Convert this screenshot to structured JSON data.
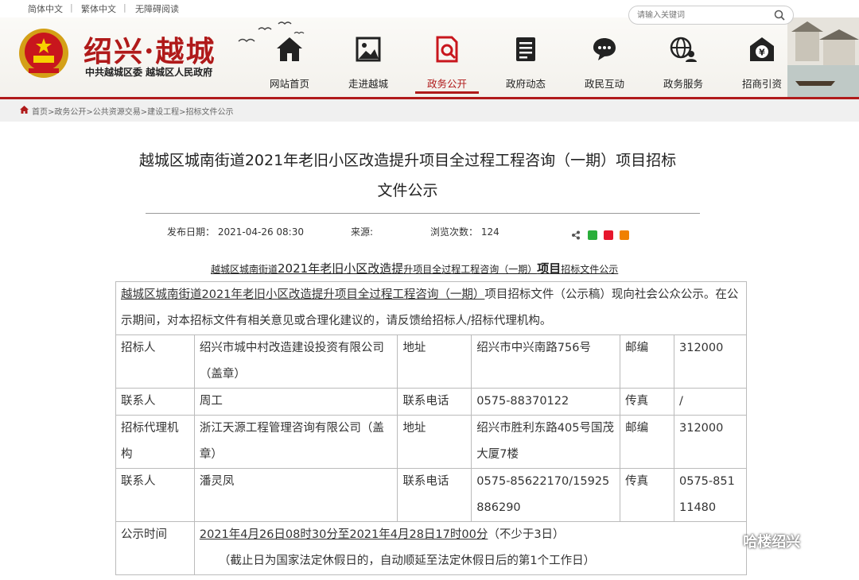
{
  "topbar": {
    "links": [
      "简体中文",
      "繁体中文",
      "无障碍阅读"
    ]
  },
  "search": {
    "placeholder": "请输入关键词"
  },
  "logo": {
    "main": "绍兴·越城",
    "sub": "中共越城区委  越城区人民政府"
  },
  "nav": [
    {
      "label": "网站首页",
      "icon": "home-icon"
    },
    {
      "label": "走进越城",
      "icon": "image-icon"
    },
    {
      "label": "政务公开",
      "icon": "search-doc-icon",
      "active": true
    },
    {
      "label": "政府动态",
      "icon": "document-icon"
    },
    {
      "label": "政民互动",
      "icon": "chat-icon"
    },
    {
      "label": "政务服务",
      "icon": "globe-user-icon"
    },
    {
      "label": "招商引资",
      "icon": "yuan-house-icon"
    }
  ],
  "breadcrumb": "首页>政务公开>公共资源交易>建设工程>招标文件公示",
  "article": {
    "title_line1": "越城区城南街道2021年老旧小区改造提升项目全过程工程咨询（一期）项目招标",
    "title_line2": "文件公示",
    "publish_label": "发布日期：",
    "publish_date": "2021-04-26 08:30",
    "source_label": "来源:",
    "views_label": "浏览次数：",
    "views": "124",
    "subhead_a": "越城区城南街道",
    "subhead_b": "2021年老旧小区改造提",
    "subhead_c": "升项目全过程工程咨询（一期）",
    "subhead_d": "项目",
    "subhead_e": "招标文件公示"
  },
  "table": {
    "intro_underlined": "越城区城南街道2021年老旧小区改造提升项目全过程工程咨询（一期）",
    "intro_rest": "项目招标文件（公示稿）现向社会公众公示。在公示期间，对本招标文件有相关意见或合理化建议的，请反馈给招标人/招标代理机构。",
    "rows": [
      {
        "c1": "招标人",
        "c2": "绍兴市城中村改造建设投资有限公司（盖章）",
        "c3": "地址",
        "c4": "绍兴市中兴南路756号",
        "c5": "邮编",
        "c6": "312000"
      },
      {
        "c1": "联系人",
        "c2": "周工",
        "c3": "联系电话",
        "c4": "0575-88370122",
        "c5": "传真",
        "c6": "/"
      },
      {
        "c1": "招标代理机构",
        "c2": "浙江天源工程管理咨询有限公司（盖章）",
        "c3": "地址",
        "c4": "绍兴市胜利东路405号国茂大厦7楼",
        "c5": "邮编",
        "c6": "312000"
      },
      {
        "c1": "联系人",
        "c2": "潘灵凤",
        "c3": "联系电话",
        "c4": "0575-85622170/15925886290",
        "c5": "传真",
        "c6": "0575-85111480"
      }
    ],
    "notice_label": "公示时间",
    "notice_time": "2021年4月26日08时30分至2021年4月28日17时00分",
    "notice_min": "（不少于3日）",
    "notice_note": "（截止日为国家法定休假日的，自动顺延至法定休假日后的第1个工作日）"
  },
  "watermark": "哈楼绍兴",
  "colors": {
    "brand": "#b01a1a"
  }
}
